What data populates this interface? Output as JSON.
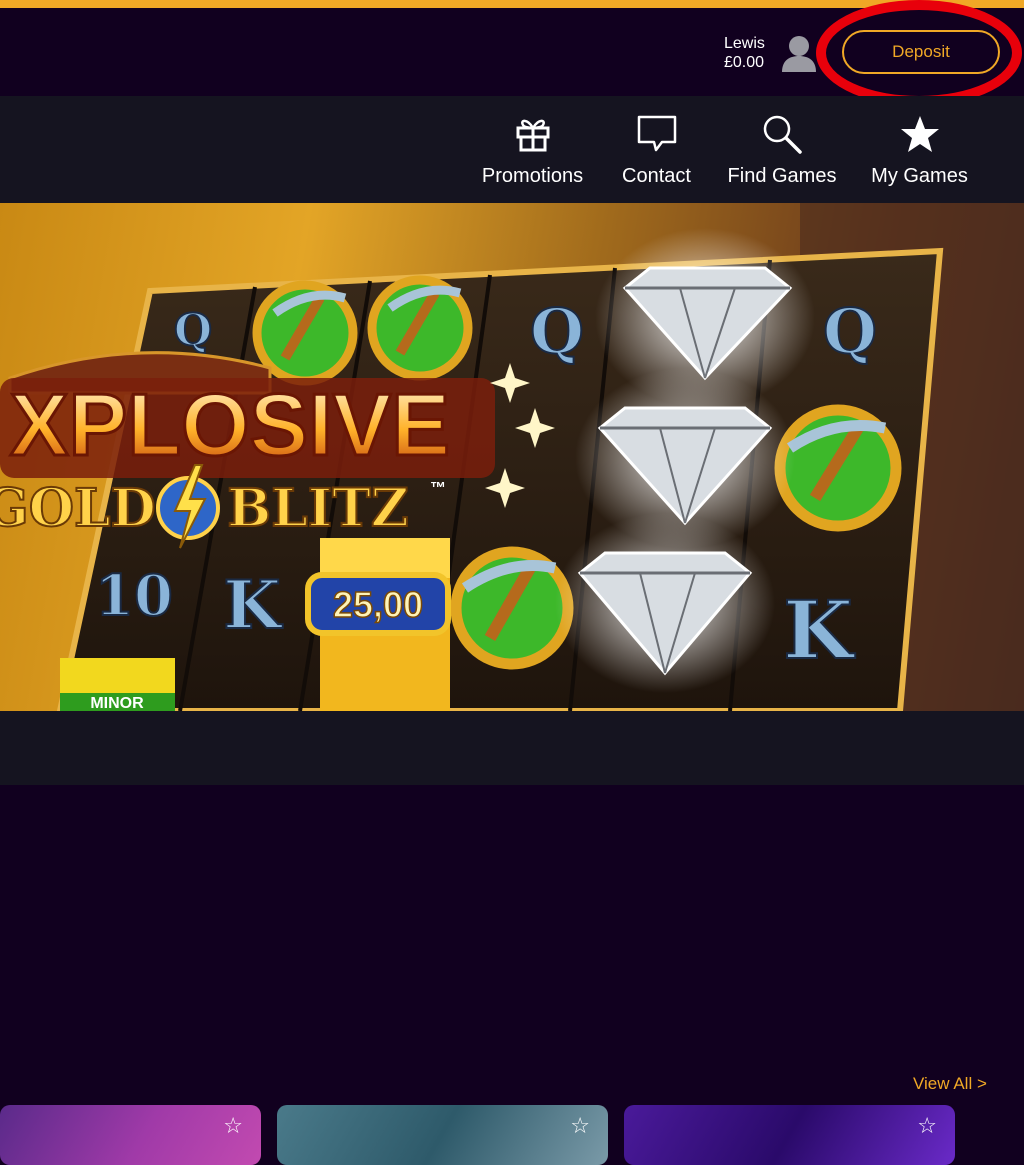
{
  "header": {
    "username": "Lewis",
    "balance": "£0.00",
    "deposit_label": "Deposit"
  },
  "nav": {
    "items": [
      {
        "label": "Promotions",
        "icon": "gift-icon"
      },
      {
        "label": "Contact",
        "icon": "chat-bubble-icon"
      },
      {
        "label": "Find Games",
        "icon": "search-icon"
      },
      {
        "label": "My Games",
        "icon": "star-icon"
      }
    ]
  },
  "banner": {
    "title_line1": "XPLOSIVE",
    "title_line2a": "GOLD",
    "title_line2b": "BLITZ",
    "trademark": "™",
    "reel_symbols": [
      "Q",
      "Q",
      "Q",
      "10",
      "K",
      "K"
    ],
    "prize_value": "25,00",
    "minor_label": "MINOR"
  },
  "games": {
    "view_all_label": "View All >",
    "favorite_icon": "☆"
  },
  "colors": {
    "accent": "#f0a826",
    "background": "#11001f",
    "nav_background": "#151420",
    "highlight": "#e8000b"
  }
}
